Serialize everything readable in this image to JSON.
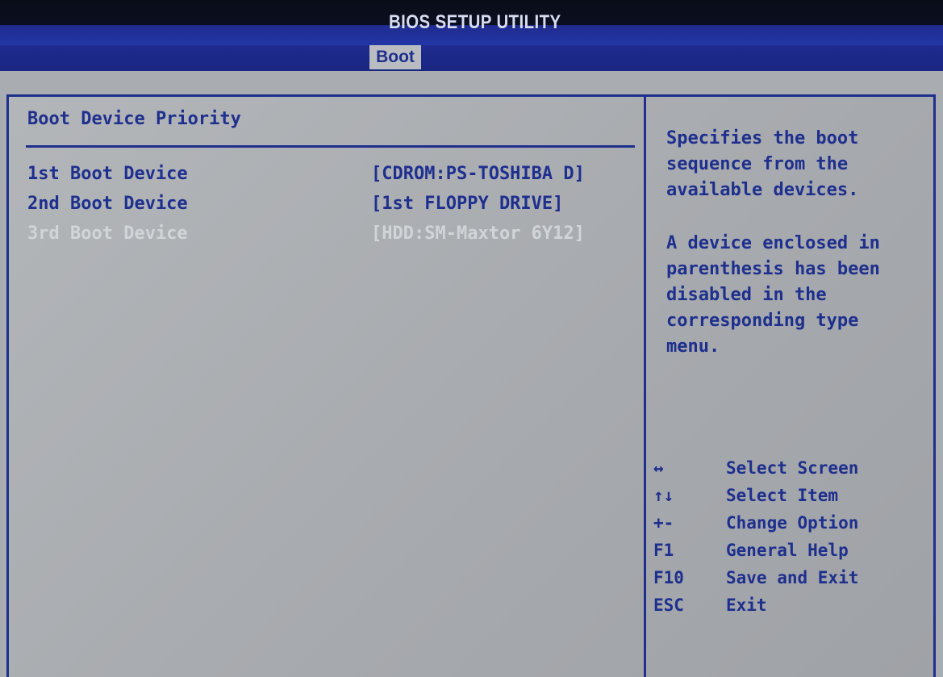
{
  "header": {
    "title": "BIOS SETUP UTILITY",
    "active_tab": "Boot"
  },
  "main": {
    "section_title": "Boot Device Priority",
    "items": [
      {
        "label": "1st Boot Device",
        "value": "[CDROM:PS-TOSHIBA D]",
        "state": "enabled"
      },
      {
        "label": "2nd Boot Device",
        "value": "[1st FLOPPY DRIVE]",
        "state": "enabled"
      },
      {
        "label": "3rd Boot Device",
        "value": "[HDD:SM-Maxtor 6Y12]",
        "state": "disabled"
      }
    ]
  },
  "help": {
    "paragraph1": [
      "Specifies the boot",
      "sequence from the",
      "available devices."
    ],
    "paragraph2": [
      "A device enclosed in",
      "parenthesis has been",
      "disabled in the",
      "corresponding type",
      "menu."
    ]
  },
  "keys": [
    {
      "key": "↔",
      "icon": "left-right-arrow-icon",
      "desc": "Select Screen"
    },
    {
      "key": "↑↓",
      "icon": "up-down-arrow-icon",
      "desc": "Select Item"
    },
    {
      "key": "+-",
      "icon": "plus-minus-icon",
      "desc": "Change Option"
    },
    {
      "key": "F1",
      "desc": "General Help"
    },
    {
      "key": "F10",
      "desc": "Save and Exit"
    },
    {
      "key": "ESC",
      "desc": "Exit"
    }
  ],
  "colors": {
    "text": "#1e2f8e",
    "background": "#a9acb0",
    "header_bg": "#0a0d18",
    "tab_strip": "#1f2b8e",
    "disabled_text": "#d2d5d8"
  }
}
